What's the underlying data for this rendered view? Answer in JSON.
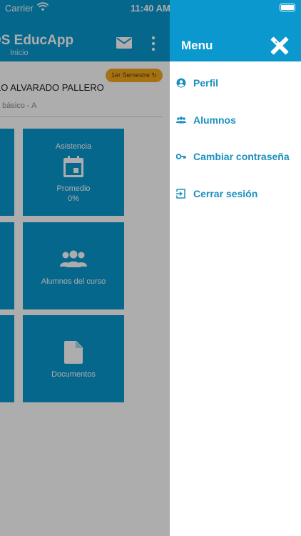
{
  "status_bar": {
    "carrier": "Carrier",
    "time": "11:40 AM"
  },
  "app_bar": {
    "title": "DS EducApp",
    "subtitle": "Inicio"
  },
  "student": {
    "name": "LO ALVARADO PALLERO",
    "course": "º básico - A",
    "semester": "1er Semestre"
  },
  "tiles": {
    "asistencia": {
      "title": "Asistencia",
      "caption": "Promedio",
      "value": "0%"
    },
    "alumnos": {
      "label": "Alumnos del curso"
    },
    "documentos": {
      "label": "Documentos"
    }
  },
  "drawer": {
    "title": "Menu",
    "items": [
      {
        "label": "Perfil",
        "icon": "account-circle-icon"
      },
      {
        "label": "Alumnos",
        "icon": "group-icon"
      },
      {
        "label": "Cambiar contraseña",
        "icon": "key-icon"
      },
      {
        "label": "Cerrar sesión",
        "icon": "logout-icon"
      }
    ]
  },
  "colors": {
    "primary": "#0a98cf",
    "accent": "#f2a81d",
    "menu_text": "#1b8fbf"
  }
}
